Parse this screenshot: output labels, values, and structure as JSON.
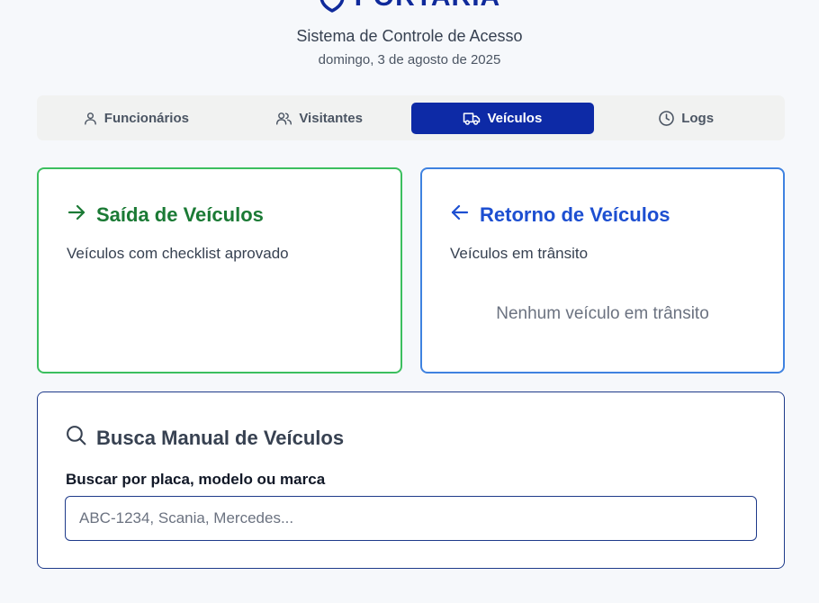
{
  "header": {
    "title": "PORTARIA",
    "subtitle": "Sistema de Controle de Acesso",
    "date": "domingo, 3 de agosto de 2025"
  },
  "tabs": [
    {
      "label": "Funcionários",
      "icon": "user-icon",
      "active": false
    },
    {
      "label": "Visitantes",
      "icon": "users-icon",
      "active": false
    },
    {
      "label": "Veículos",
      "icon": "truck-icon",
      "active": true
    },
    {
      "label": "Logs",
      "icon": "clock-icon",
      "active": false
    }
  ],
  "exit_card": {
    "title": "Saída de Veículos",
    "description": "Veículos com checklist aprovado",
    "icon": "arrow-right-icon"
  },
  "return_card": {
    "title": "Retorno de Veículos",
    "description": "Veículos em trânsito",
    "empty_message": "Nenhum veículo em trânsito",
    "icon": "arrow-left-icon"
  },
  "search": {
    "title": "Busca Manual de Veículos",
    "label": "Buscar por placa, modelo ou marca",
    "placeholder": "ABC-1234, Scania, Mercedes...",
    "value": "",
    "icon": "search-icon"
  },
  "colors": {
    "brand": "#0f2a9b",
    "active_tab": "#0d2aa6",
    "exit_green": "#1b7a35",
    "exit_border": "#3cbf5f",
    "return_blue": "#1d4fd1",
    "return_border": "#3f82e0"
  }
}
